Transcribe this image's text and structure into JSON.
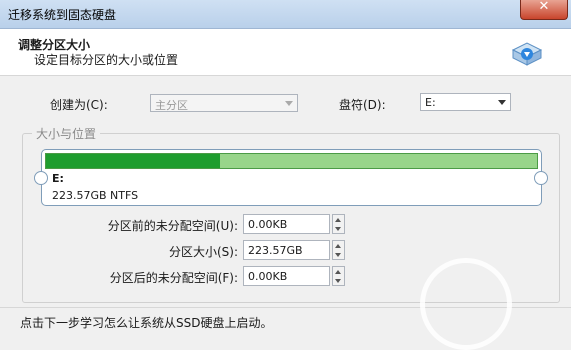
{
  "window": {
    "title": "迁移系统到固态硬盘",
    "close_glyph": "✕"
  },
  "header": {
    "title": "调整分区大小",
    "subtitle": "设定目标分区的大小或位置",
    "icon": "disk-icon"
  },
  "create_as": {
    "label": "创建为(C):",
    "value": "主分区"
  },
  "drive_letter": {
    "label": "盘符(D):",
    "value": "E:"
  },
  "group": {
    "title": "大小与位置"
  },
  "partition": {
    "letter": "E:",
    "info": "223.57GB NTFS",
    "used_fraction": 0.355
  },
  "fields": [
    {
      "label": "分区前的未分配空间(U):",
      "value": "0.00KB"
    },
    {
      "label": "分区大小(S):",
      "value": "223.57GB"
    },
    {
      "label": "分区后的未分配空间(F):",
      "value": "0.00KB"
    }
  ],
  "hint": "点击下一步学习怎么让系统从SSD硬盘上启动。",
  "colors": {
    "bar_used": "#1f9d2e",
    "bar_free": "#98d58a",
    "title_bar": "#b9d0ea",
    "close": "#c9452c"
  }
}
